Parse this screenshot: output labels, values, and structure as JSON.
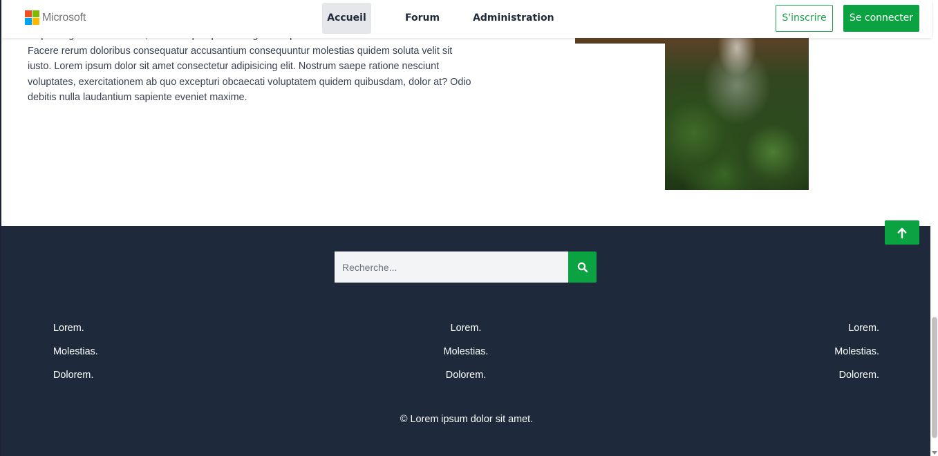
{
  "header": {
    "logo_text": "Microsoft",
    "logo_colors": [
      "#f25022",
      "#7fba00",
      "#00a4ef",
      "#ffb900"
    ],
    "nav": [
      "Accueil",
      "Forum",
      "Administration"
    ],
    "active_nav": "Accueil",
    "signup_label": "S'inscrire",
    "login_label": "Se connecter"
  },
  "main": {
    "paragraph_cut_line": "adipisicing elit. Mollitia odit, ut dolore perspiciatis fugiat voluptas vitae accusamus laborum.",
    "paragraph": "Facere rerum doloribus consequatur accusantium consequuntur molestias quidem soluta velit sit iusto. Lorem ipsum dolor sit amet consectetur adipisicing elit. Nostrum saepe ratione nesciunt voluptates, exercitationem ab quo excepturi obcaecati voluptatem quidem quibusdam, dolor at? Odio debitis nulla laudantium sapiente eveniet maxime."
  },
  "footer": {
    "search_placeholder": "Recherche...",
    "search_icon": "search-icon",
    "columns": [
      [
        "Lorem.",
        "Molestias.",
        "Dolorem."
      ],
      [
        "Lorem.",
        "Molestias.",
        "Dolorem."
      ],
      [
        "Lorem.",
        "Molestias.",
        "Dolorem."
      ]
    ],
    "copyright": "© Lorem ipsum dolor sit amet."
  },
  "back_to_top_icon": "arrow-up-icon",
  "colors": {
    "accent_green": "#0ba341",
    "footer_bg": "#1e293b",
    "nav_active_bg": "#e5e7eb"
  }
}
